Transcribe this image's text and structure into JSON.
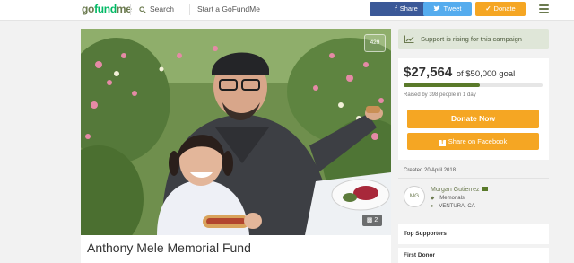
{
  "header": {
    "logo": {
      "part1": "go",
      "part2": "fund",
      "part3": "me"
    },
    "search_label": "Search",
    "start_label": "Start a GoFundMe",
    "share_icon": "f",
    "share_label": "Share",
    "tweet_label": "Tweet",
    "donate_label": "Donate",
    "menu_icon": "hamburger-menu-icon"
  },
  "campaign": {
    "title": "Anthony Mele Memorial Fund",
    "heart_count": "429",
    "photo_count": "2",
    "rising_text": "Support is rising for this campaign",
    "raised": "$27,564",
    "goal_text": "of $50,000 goal",
    "progress_fraction": 0.55,
    "stat_text": "Raised by 398 people in 1 day",
    "donate_now_label": "Donate Now",
    "fb_icon": "f",
    "share_fb_label": "Share on Facebook",
    "created": "Created 20 April 2018"
  },
  "organizer": {
    "initials": "MG",
    "name": "Morgan Gutierrez",
    "category": "Memorials",
    "location": "VENTURA, CA"
  },
  "sections": {
    "top_supporters": "Top Supporters",
    "first_donor": "First Donor"
  },
  "colors": {
    "brand_green": "#00b964",
    "accent_orange": "#f5a623",
    "facebook_blue": "#3b5998",
    "twitter_blue": "#55acee",
    "progress_green": "#5a7a2a"
  }
}
